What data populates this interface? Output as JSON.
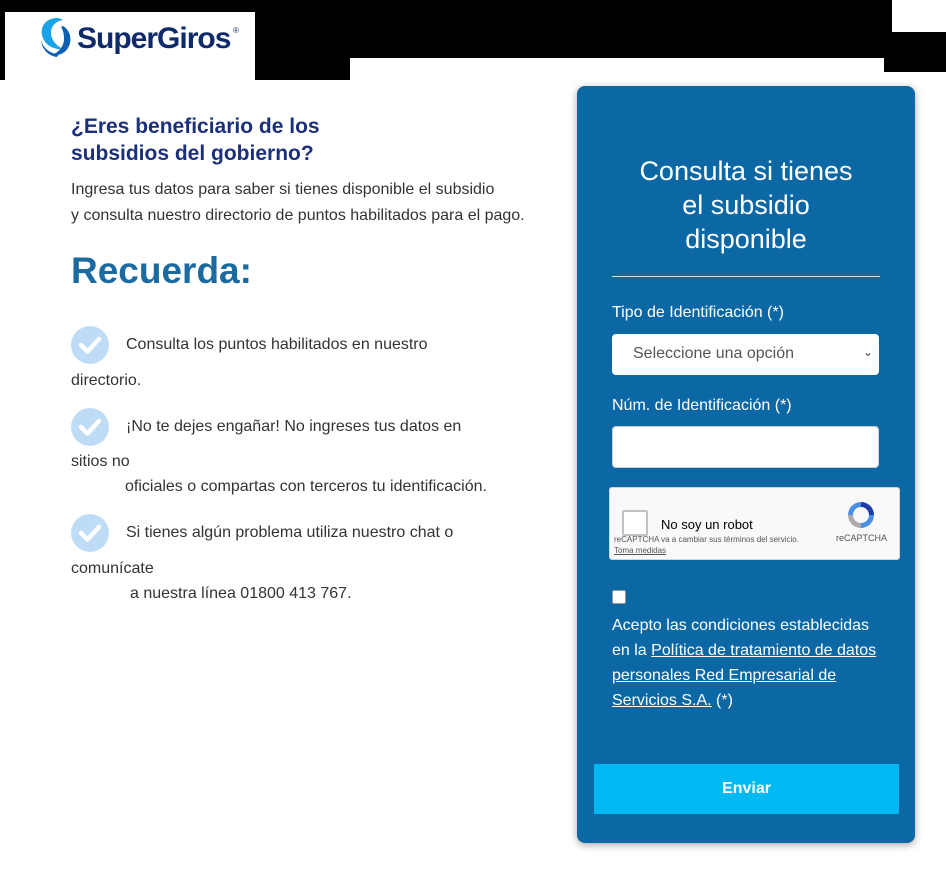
{
  "header": {
    "brand": "SuperGiros",
    "brand_mark": "®"
  },
  "main": {
    "question_line1": "¿Eres beneficiario de los",
    "question_line2": "subsidios del gobierno?",
    "intro_line1": "Ingresa tus datos para saber si tienes disponible el subsidio",
    "intro_line2": "y consulta nuestro directorio de puntos habilitados para el pago.",
    "remember_title": "Recuerda:",
    "tips": [
      {
        "line1": "Consulta los puntos habilitados en nuestro",
        "line2": "directorio.",
        "line3": ""
      },
      {
        "line1": "¡No te dejes engañar! No ingreses tus datos en",
        "line2": "sitios no",
        "line3": "oficiales o compartas con terceros tu identificación."
      },
      {
        "line1": "Si tienes algún problema utiliza nuestro chat o",
        "line2": "comunícate",
        "line3": "a nuestra línea 01800 413 767."
      }
    ]
  },
  "form": {
    "title_line1": "Consulta si tienes",
    "title_line2": "el subsidio",
    "title_line3": "disponible",
    "id_type_label": "Tipo de Identificación (*)",
    "id_type_selected": "Seleccione una opción",
    "id_number_label": "Núm. de Identificación (*)",
    "id_number_value": "",
    "captcha": {
      "label": "No soy un robot",
      "notice": "reCAPTCHA va a cambiar sus términos del servicio.",
      "notice_link": "Toma medidas",
      "brand": "reCAPTCHA"
    },
    "accept_prefix": "Acepto las condiciones establecidas en la ",
    "accept_link": "Política de tratamiento de datos personales Red Empresarial de Servicios S.A.",
    "accept_suffix": " (*)",
    "submit_label": "Enviar"
  },
  "colors": {
    "panel": "#0b68a5",
    "button": "#00b9f2",
    "heading": "#1b2f7a",
    "accent": "#1b6aa0"
  }
}
